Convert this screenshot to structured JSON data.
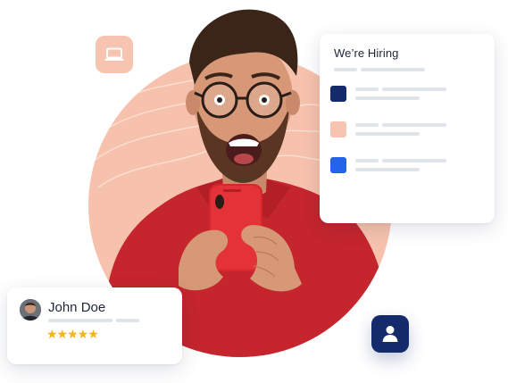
{
  "hero": {
    "hiring_card": {
      "title": "We’re Hiring",
      "rows": [
        {
          "color": "#132a6b"
        },
        {
          "color": "#f6c4b1"
        },
        {
          "color": "#2563eb"
        }
      ]
    },
    "review_card": {
      "name": "John Doe",
      "stars": "★★★★★",
      "rating": 5
    },
    "icons": {
      "laptop": "laptop-icon",
      "user": "user-icon"
    },
    "colors": {
      "accent_peach": "#f6c4b1",
      "accent_navy": "#132a6b",
      "accent_blue": "#2563eb",
      "shirt_red": "#c5252c",
      "star_gold": "#f3b41b"
    }
  }
}
